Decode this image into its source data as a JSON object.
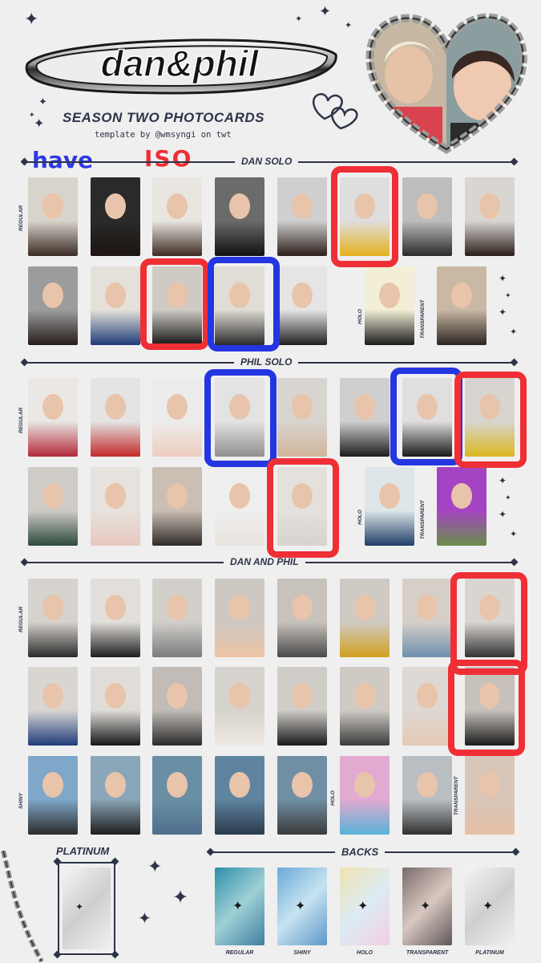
{
  "header": {
    "logo_text": "dan&phil",
    "subtitle": "SEASON TWO PHOTOCARDS",
    "credit": "template by @wmsyngi on twt"
  },
  "annotations": {
    "have": "have",
    "iso": "ISO"
  },
  "sections": {
    "dan_solo": {
      "title": "DAN SOLO",
      "labels": {
        "regular": "REGULAR",
        "holo": "HOLO",
        "transparent": "TRANSPARENT"
      }
    },
    "phil_solo": {
      "title": "PHIL SOLO",
      "labels": {
        "regular": "REGULAR",
        "holo": "HOLO",
        "transparent": "TRANSPARENT"
      }
    },
    "dan_and_phil": {
      "title": "DAN AND PHIL",
      "labels": {
        "regular": "REGULAR",
        "shiny": "SHINY",
        "holo": "HOLO",
        "transparent": "TRANSPARENT"
      }
    },
    "platinum": {
      "title": "PLATINUM"
    },
    "backs": {
      "title": "BACKS",
      "labels": [
        "REGULAR",
        "SHINY",
        "HOLO",
        "TRANSPARENT",
        "PLATINUM"
      ]
    }
  },
  "colors": {
    "have_marker": "#2436e0",
    "iso_marker": "#ef2f35",
    "ink": "#2d3448",
    "background": "#efefef"
  }
}
